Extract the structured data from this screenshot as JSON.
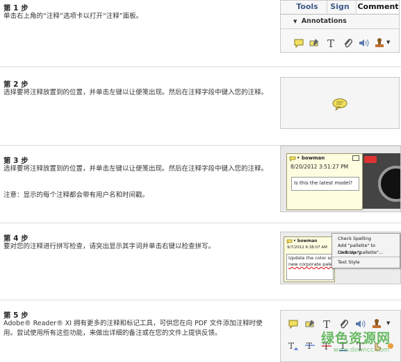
{
  "steps": [
    {
      "title": "第 1 步",
      "desc": "单击右上角的“注释”选项卡以打开“注释”面板。"
    },
    {
      "title": "第 2 步",
      "desc": "选择要将注释放置到的位置，并单击左键以让便笺出现。然后在注释字段中键入您的注释。"
    },
    {
      "title": "第 3 步",
      "desc": "选择要将注释放置到的位置，并单击左键以让便笺出现。然后在注释字段中键入您的注释。",
      "note": "注意：显示的每个注释都会带有用户名和时间戳。"
    },
    {
      "title": "第 4 步",
      "desc": "要对您的注释进行拼写检查，请突出显示其字词并单击右键以检查拼写。"
    },
    {
      "title": "第 5 步",
      "desc": "Adobe® Reader® XI 拥有更多的注释和标记工具，可供您在向 PDF 文件添加注释时使用。尝试使用所有这些功能，来做出详细的备注或在您的文件上提供反馈。"
    }
  ],
  "panel1": {
    "tabs": [
      "Tools",
      "Sign",
      "Comment"
    ],
    "annotations_label": "Annotations"
  },
  "step3_note": {
    "user": "• bowman",
    "date": "8/20/2012 3:51:27 PM",
    "text": "Is this the latest model?"
  },
  "step4_note": {
    "user": "• bowman",
    "date": "9/7/2012 6:38:07 AM",
    "text1": "Update the color sch",
    "text2": "new corporate palett"
  },
  "context_menu": {
    "items": [
      "Check Spelling",
      "Add \"pallette\" to Dictionary",
      "Look Up \"pallette\"...",
      "Text Style"
    ]
  },
  "watermark": "绿色资源网",
  "watermark_url": "www.downcc.com",
  "colors": {
    "tab_text": "#3d5a88",
    "note_yellow": "#f0e060",
    "watermark_green": "#3aa634"
  }
}
